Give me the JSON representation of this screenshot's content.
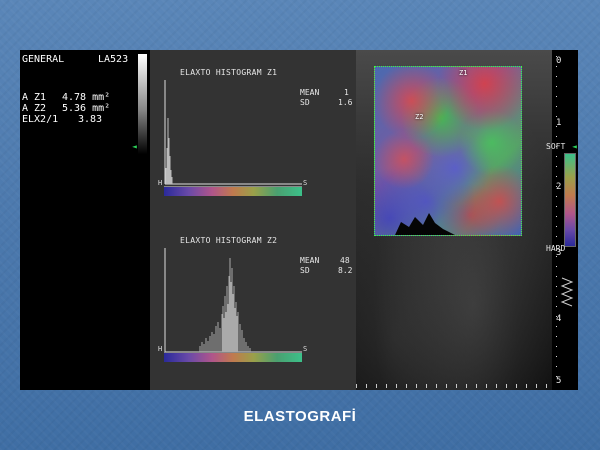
{
  "device": {
    "general_label": "GENERAL",
    "probe": "LA523",
    "measurements": [
      {
        "label": "A Z1",
        "value": "4.78 mm²"
      },
      {
        "label": "A Z2",
        "value": "5.36 mm²"
      },
      {
        "label": "ELX2/1",
        "value": "3.83"
      }
    ]
  },
  "histogram1": {
    "title": "ELAXTO HISTOGRAM Z1",
    "mean_label": "MEAN",
    "mean_value": "1",
    "sd_label": "SD",
    "sd_value": "1.6",
    "axis_h": "H",
    "axis_s": "S"
  },
  "histogram2": {
    "title": "ELAXTO HISTOGRAM Z2",
    "mean_label": "MEAN",
    "mean_value": "48",
    "sd_label": "SD",
    "sd_value": "8.2",
    "axis_h": "H",
    "axis_s": "S"
  },
  "image": {
    "roi1_label": "Z1",
    "roi2_label": "Z2",
    "depth_marks": [
      "0",
      "1",
      "2",
      "3",
      "4",
      "5"
    ],
    "scale_soft": "SOFT",
    "scale_hard": "HARD"
  },
  "caption": "ELASTOGRAFİ",
  "colors": {
    "roi_border": "#3cff3c",
    "marker": "#2dd35a",
    "panel": "#333333"
  }
}
